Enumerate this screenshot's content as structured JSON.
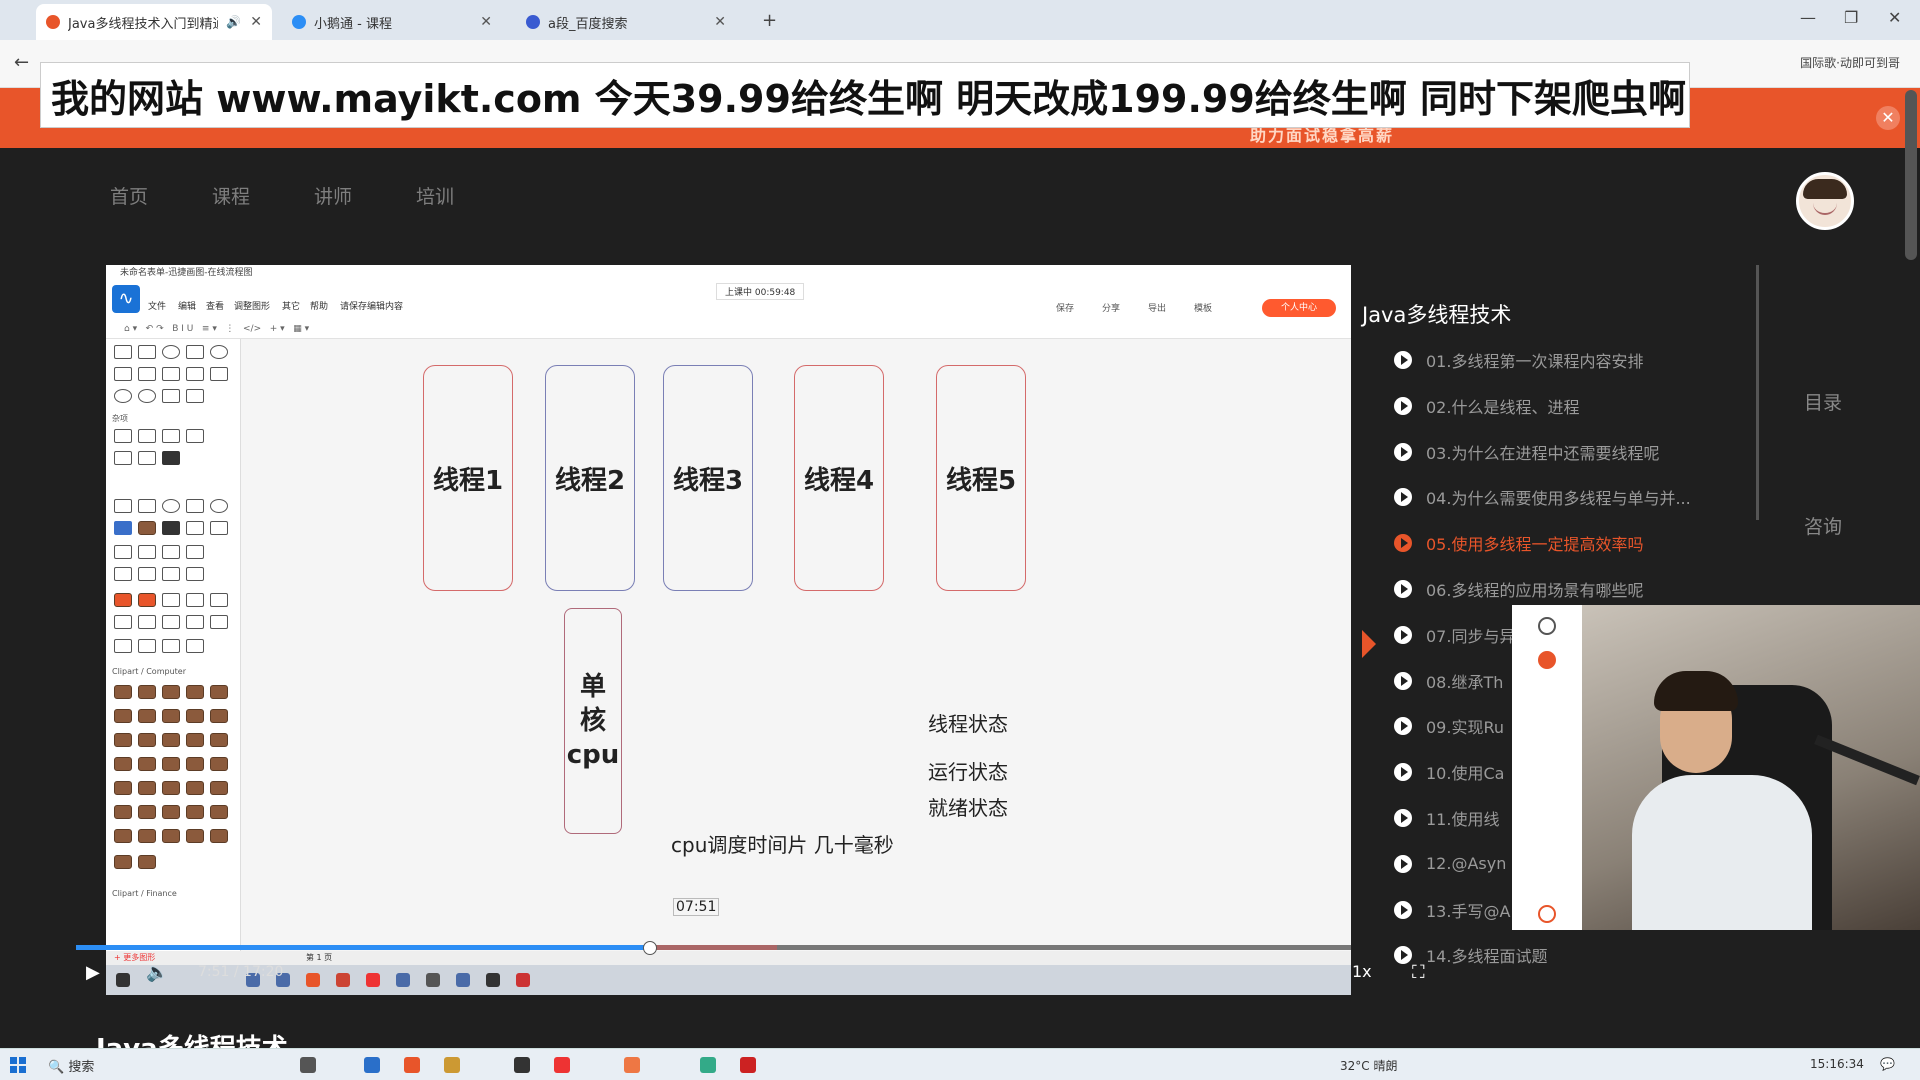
{
  "browser": {
    "tabs": [
      {
        "label": "Java多线程技术入门到精通"
      },
      {
        "label": "小鹅通 - 课程"
      },
      {
        "label": "a段_百度搜索"
      }
    ],
    "addr_right_text": "国际歌·动即可到哥"
  },
  "banner": {
    "overlay_text": "我的网站 www.mayikt.com   今天39.99给终生啊 明天改成199.99给终生啊   同时下架爬虫啊",
    "strip_text": "助力面试稳拿高薪"
  },
  "site_nav": {
    "items": [
      "首页",
      "课程",
      "讲师",
      "培训"
    ]
  },
  "app": {
    "title": "未命名表单-迅捷画图-在线流程图",
    "menu": [
      "文件",
      "编辑",
      "查看",
      "调整图形",
      "其它",
      "帮助",
      "请保存编辑内容"
    ],
    "recording": "上课中 00:59:48",
    "toolbar_right": [
      "保存",
      "分享",
      "导出",
      "模板"
    ],
    "orange_button": "个人中心",
    "panel_labels": [
      "杂项",
      "Clipart / Computer",
      "Clipart / Finance"
    ],
    "sheet_tabs": [
      "+ 更多图形",
      "第 1 页"
    ]
  },
  "canvas": {
    "threads": [
      "线程1",
      "线程2",
      "线程3",
      "线程4",
      "线程5"
    ],
    "cpu_lines": [
      "单",
      "核",
      "cpu"
    ],
    "state_title": "线程状态",
    "state_running": "运行状态",
    "state_ready": "就绪状态",
    "slice_note": "cpu调度时间片 几十毫秒",
    "timer": "07:51"
  },
  "player": {
    "time": "7:51 / 17:20",
    "speed": "1x",
    "progress": 0.45,
    "buffered": 0.55
  },
  "playlist": {
    "title": "Java多线程技术",
    "items": [
      {
        "label": "01.多线程第一次课程内容安排",
        "active": false
      },
      {
        "label": "02.什么是线程、进程",
        "active": false
      },
      {
        "label": "03.为什么在进程中还需要线程呢",
        "active": false
      },
      {
        "label": "04.为什么需要使用多线程与单与并...",
        "active": false
      },
      {
        "label": "05.使用多线程一定提高效率吗",
        "active": true
      },
      {
        "label": "06.多线程的应用场景有哪些呢",
        "active": false
      },
      {
        "label": "07.同步与异",
        "active": false
      },
      {
        "label": "08.继承Th",
        "active": false
      },
      {
        "label": "09.实现Ru",
        "active": false
      },
      {
        "label": "10.使用Ca",
        "active": false
      },
      {
        "label": "11.使用线",
        "active": false
      },
      {
        "label": "12.@Asyn",
        "active": false
      },
      {
        "label": "13.手写@A",
        "active": false
      },
      {
        "label": "14.多线程面试题",
        "active": false
      }
    ],
    "side_links": [
      "目录",
      "咨询"
    ]
  },
  "page": {
    "heading_peek": "Java多线程技术"
  },
  "taskbar": {
    "search": "搜索",
    "weather": "32°C 晴朗",
    "time": "15:16:34"
  },
  "colors": {
    "accent": "#e8552a",
    "progress": "#2c8ef5"
  }
}
